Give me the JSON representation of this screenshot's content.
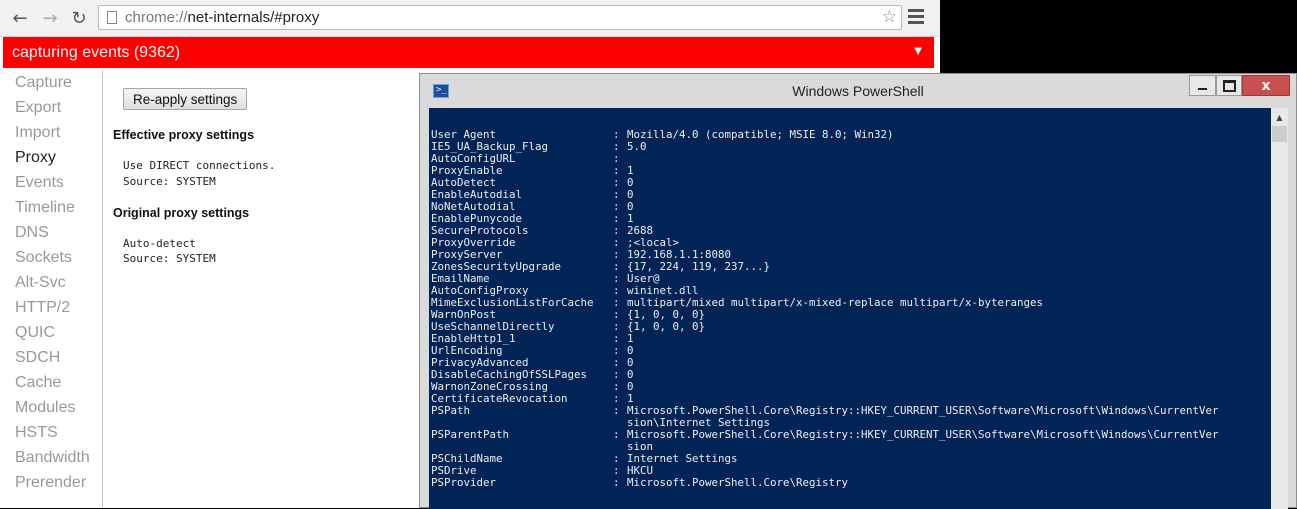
{
  "browser": {
    "url_scheme": "chrome://",
    "url_rest": "net-internals/#proxy",
    "status_text": "capturing events (9362)",
    "status_color": "#ff0000",
    "icons": [
      "back-icon",
      "forward-icon",
      "reload-icon",
      "page-icon",
      "star-icon",
      "menu-icon",
      "chevron-down-icon"
    ],
    "sidebar": [
      {
        "label": "Capture",
        "active": false
      },
      {
        "label": "Export",
        "active": false
      },
      {
        "label": "Import",
        "active": false
      },
      {
        "label": "Proxy",
        "active": true
      },
      {
        "label": "Events",
        "active": false
      },
      {
        "label": "Timeline",
        "active": false
      },
      {
        "label": "DNS",
        "active": false
      },
      {
        "label": "Sockets",
        "active": false
      },
      {
        "label": "Alt-Svc",
        "active": false
      },
      {
        "label": "HTTP/2",
        "active": false
      },
      {
        "label": "QUIC",
        "active": false
      },
      {
        "label": "SDCH",
        "active": false
      },
      {
        "label": "Cache",
        "active": false
      },
      {
        "label": "Modules",
        "active": false
      },
      {
        "label": "HSTS",
        "active": false
      },
      {
        "label": "Bandwidth",
        "active": false
      },
      {
        "label": "Prerender",
        "active": false
      }
    ],
    "content": {
      "reapply_label": "Re-apply settings",
      "effective_title": "Effective proxy settings",
      "effective_lines": [
        "Use DIRECT connections.",
        "Source: SYSTEM"
      ],
      "original_title": "Original proxy settings",
      "original_lines": [
        "Auto-detect",
        "Source: SYSTEM"
      ]
    }
  },
  "powershell": {
    "title": "Windows PowerShell",
    "close_label": "x",
    "icons": [
      "powershell-icon",
      "minimize-icon",
      "maximize-icon",
      "close-icon",
      "scroll-up-icon"
    ],
    "background_color": "#012456",
    "lines": [
      {
        "key": "User Agent",
        "sep": ":",
        "value": "Mozilla/4.0 (compatible; MSIE 8.0; Win32)"
      },
      {
        "key": "IE5_UA_Backup_Flag",
        "sep": ":",
        "value": "5.0"
      },
      {
        "key": "AutoConfigURL",
        "sep": ":",
        "value": ""
      },
      {
        "key": "ProxyEnable",
        "sep": ":",
        "value": "1"
      },
      {
        "key": "AutoDetect",
        "sep": ":",
        "value": "0"
      },
      {
        "key": "EnableAutodial",
        "sep": ":",
        "value": "0"
      },
      {
        "key": "NoNetAutodial",
        "sep": ":",
        "value": "0"
      },
      {
        "key": "EnablePunycode",
        "sep": ":",
        "value": "1"
      },
      {
        "key": "SecureProtocols",
        "sep": ":",
        "value": "2688"
      },
      {
        "key": "ProxyOverride",
        "sep": ":",
        "value": ";<local>"
      },
      {
        "key": "ProxyServer",
        "sep": ":",
        "value": "192.168.1.1:8080"
      },
      {
        "key": "ZonesSecurityUpgrade",
        "sep": ":",
        "value": "{17, 224, 119, 237...}"
      },
      {
        "key": "EmailName",
        "sep": ":",
        "value": "User@"
      },
      {
        "key": "AutoConfigProxy",
        "sep": ":",
        "value": "wininet.dll"
      },
      {
        "key": "MimeExclusionListForCache",
        "sep": ":",
        "value": "multipart/mixed multipart/x-mixed-replace multipart/x-byteranges"
      },
      {
        "key": "WarnOnPost",
        "sep": ":",
        "value": "{1, 0, 0, 0}"
      },
      {
        "key": "UseSchannelDirectly",
        "sep": ":",
        "value": "{1, 0, 0, 0}"
      },
      {
        "key": "EnableHttp1_1",
        "sep": ":",
        "value": "1"
      },
      {
        "key": "UrlEncoding",
        "sep": ":",
        "value": "0"
      },
      {
        "key": "PrivacyAdvanced",
        "sep": ":",
        "value": "0"
      },
      {
        "key": "DisableCachingOfSSLPages",
        "sep": ":",
        "value": "0"
      },
      {
        "key": "WarnonZoneCrossing",
        "sep": ":",
        "value": "0"
      },
      {
        "key": "CertificateRevocation",
        "sep": ":",
        "value": "1"
      },
      {
        "key": "PSPath",
        "sep": ":",
        "value": "Microsoft.PowerShell.Core\\Registry::HKEY_CURRENT_USER\\Software\\Microsoft\\Windows\\CurrentVer"
      },
      {
        "key": "",
        "sep": "",
        "value": "sion\\Internet Settings"
      },
      {
        "key": "PSParentPath",
        "sep": ":",
        "value": "Microsoft.PowerShell.Core\\Registry::HKEY_CURRENT_USER\\Software\\Microsoft\\Windows\\CurrentVer"
      },
      {
        "key": "",
        "sep": "",
        "value": "sion"
      },
      {
        "key": "PSChildName",
        "sep": ":",
        "value": "Internet Settings"
      },
      {
        "key": "PSDrive",
        "sep": ":",
        "value": "HKCU"
      },
      {
        "key": "PSProvider",
        "sep": ":",
        "value": "Microsoft.PowerShell.Core\\Registry"
      }
    ]
  }
}
